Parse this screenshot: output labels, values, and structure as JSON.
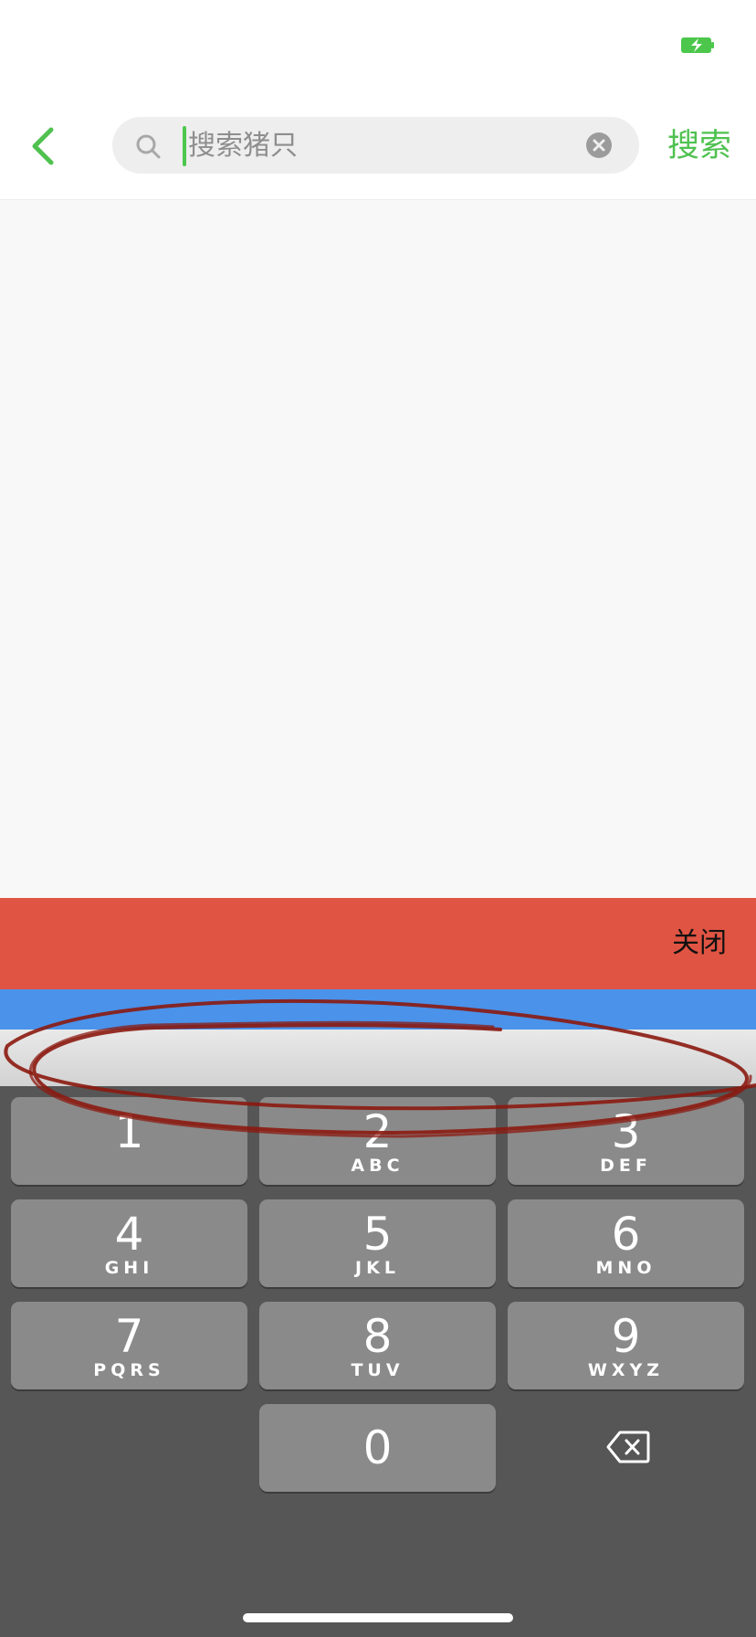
{
  "status_bar": {
    "battery_icon": "battery-charging-icon"
  },
  "nav": {
    "back_icon": "chevron-left-icon",
    "search_placeholder": "搜索猪只",
    "search_value": "",
    "search_button_label": "搜索"
  },
  "toolbar": {
    "close_label": "关闭"
  },
  "keypad": {
    "keys": [
      {
        "digit": "1",
        "letters": ""
      },
      {
        "digit": "2",
        "letters": "ABC"
      },
      {
        "digit": "3",
        "letters": "DEF"
      },
      {
        "digit": "4",
        "letters": "GHI"
      },
      {
        "digit": "5",
        "letters": "JKL"
      },
      {
        "digit": "6",
        "letters": "MNO"
      },
      {
        "digit": "7",
        "letters": "PQRS"
      },
      {
        "digit": "8",
        "letters": "TUV"
      },
      {
        "digit": "9",
        "letters": "WXYZ"
      }
    ],
    "zero": "0",
    "delete_icon": "backspace-icon"
  },
  "colors": {
    "accent": "#4fc14f",
    "close_bar": "#e05443",
    "blue_bar": "#4a92ea",
    "keyboard_bg": "#565656",
    "key_bg": "#8a8a8a",
    "annotation": "#8b1a10"
  }
}
